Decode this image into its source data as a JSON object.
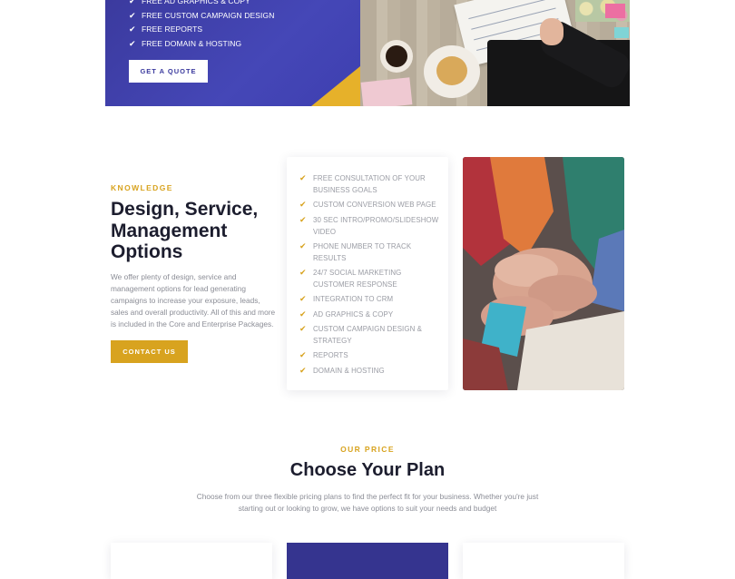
{
  "hero": {
    "features": [
      "FREE AD GRAPHICS & COPY",
      "FREE CUSTOM CAMPAIGN DESIGN",
      "FREE REPORTS",
      "FREE DOMAIN & HOSTING"
    ],
    "quote_button": "GET A QUOTE"
  },
  "knowledge": {
    "eyebrow": "KNOWLEDGE",
    "title": "Design, Service, Management Options",
    "description": "We offer plenty of design, service and management options for lead generating campaigns to increase your exposure, leads, sales and overall productivity. All of this and more is included in the Core and Enterprise Packages.",
    "contact_button": "CONTACT US",
    "features": [
      "FREE CONSULTATION OF YOUR BUSINESS GOALS",
      "CUSTOM CONVERSION WEB PAGE",
      "30 SEC INTRO/PROMO/SLIDESHOW VIDEO",
      "PHONE NUMBER TO TRACK RESULTS",
      "24/7 SOCIAL MARKETING CUSTOMER RESPONSE",
      "INTEGRATION TO CRM",
      "AD GRAPHICS & COPY",
      "CUSTOM CAMPAIGN DESIGN & STRATEGY",
      "REPORTS",
      "DOMAIN & HOSTING"
    ]
  },
  "pricing": {
    "eyebrow": "OUR PRICE",
    "title": "Choose Your Plan",
    "description": "Choose from our three flexible pricing plans to find the perfect fit for your business. Whether you're just starting out or looking to grow, we have options to suit your needs and budget"
  },
  "colors": {
    "brand_blue": "#3b3a9e",
    "accent_gold": "#d8a31f",
    "heading": "#1c1d2e",
    "body_text": "#8b8d96"
  },
  "icons": {
    "check": "check-icon"
  }
}
